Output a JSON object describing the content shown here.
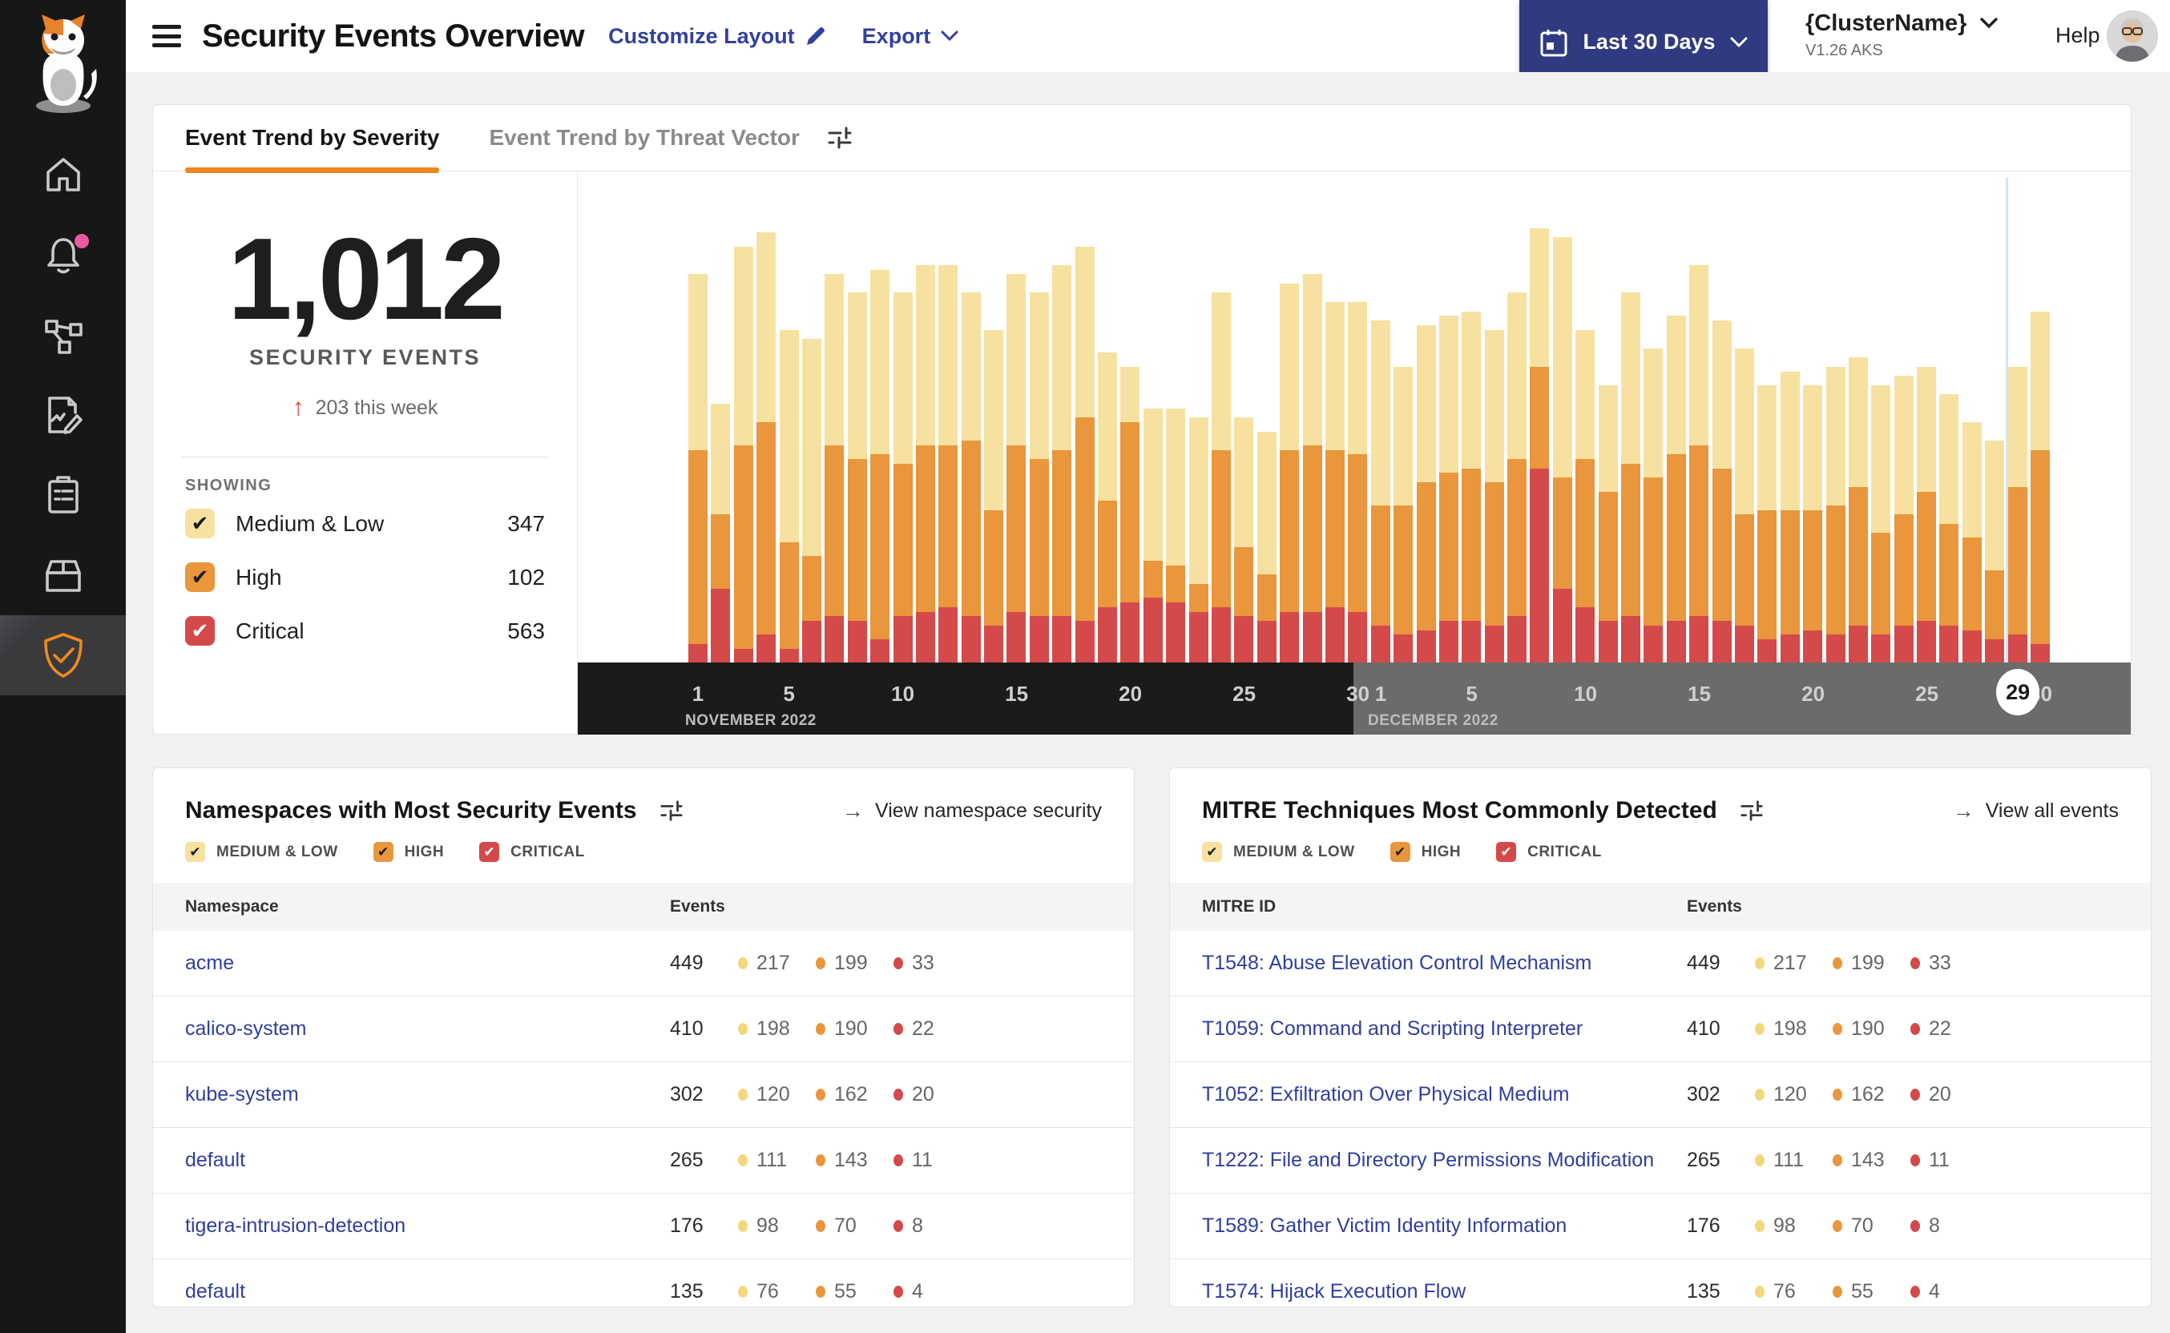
{
  "header": {
    "title": "Security Events Overview",
    "customize_layout": "Customize Layout",
    "export": "Export",
    "date_range": "Last 30 Days",
    "cluster_name": "{ClusterName}",
    "cluster_version": "V1.26 AKS",
    "help": "Help"
  },
  "tabs": {
    "severity": "Event Trend by Severity",
    "threat_vector": "Event Trend by Threat Vector"
  },
  "summary": {
    "total": "1,012",
    "label": "SECURITY EVENTS",
    "delta": "203 this week",
    "showing_label": "SHOWING",
    "filters": [
      {
        "label": "Medium & Low",
        "count": "347",
        "box": "#F6E1A0",
        "check": "#1C1C1C"
      },
      {
        "label": "High",
        "count": "102",
        "box": "#E9963C",
        "check": "#1C1C1C"
      },
      {
        "label": "Critical",
        "count": "563",
        "box": "#D4494A",
        "check": "#FFFFFF"
      }
    ]
  },
  "colors": {
    "medium_low": "#F6E1A0",
    "high": "#E9963C",
    "critical": "#D4494A",
    "accent_orange": "#F0861F",
    "navy": "#2F3A80",
    "link_navy": "#32409F",
    "axis_nov_bg": "#1B1B1B",
    "axis_dec_bg": "#6B6B6B",
    "now_line": "#CFE6F5"
  },
  "chart_data": {
    "type": "bar",
    "stacked": true,
    "title": "Event Trend by Severity (security events per day)",
    "x_axis": {
      "months": [
        {
          "label": "NOVEMBER 2022",
          "ticks": [
            1,
            5,
            10,
            15,
            20,
            25,
            30
          ],
          "days": 30
        },
        {
          "label": "DECEMBER 2022",
          "ticks": [
            1,
            5,
            10,
            15,
            20,
            25,
            30
          ],
          "days": 30,
          "selected_day": 29
        }
      ]
    },
    "y_axis": {
      "visible": false,
      "values_unit": "percent_of_plot_height"
    },
    "legend_position": "left-panel-checkboxes",
    "series": [
      {
        "name": "Medium & Low",
        "color": "#F6E1A0",
        "values": [
          38,
          24,
          43,
          41,
          46,
          47,
          37,
          36,
          40,
          37,
          39,
          39,
          32,
          39,
          37,
          36,
          40,
          37,
          32,
          12,
          33,
          34,
          36,
          34,
          28,
          31,
          36,
          37,
          32,
          33,
          40,
          30,
          34,
          34,
          34,
          33,
          36,
          30,
          52,
          28,
          23,
          37,
          28,
          30,
          39,
          32,
          36,
          27,
          30,
          27,
          30,
          28,
          32,
          30,
          27,
          28,
          25,
          28,
          26,
          30
        ]
      },
      {
        "name": "High",
        "color": "#E9963C",
        "values": [
          42,
          16,
          44,
          46,
          23,
          14,
          37,
          35,
          40,
          33,
          36,
          35,
          38,
          25,
          36,
          34,
          36,
          44,
          23,
          39,
          8,
          8,
          6,
          34,
          15,
          10,
          35,
          36,
          34,
          34,
          26,
          28,
          32,
          32,
          33,
          31,
          34,
          22,
          24,
          32,
          28,
          33,
          32,
          36,
          37,
          33,
          24,
          28,
          27,
          26,
          28,
          30,
          22,
          24,
          28,
          22,
          20,
          15,
          32,
          42
        ]
      },
      {
        "name": "Critical",
        "color": "#D4494A",
        "values": [
          4,
          16,
          3,
          6,
          3,
          9,
          10,
          9,
          5,
          10,
          11,
          12,
          10,
          8,
          11,
          10,
          10,
          9,
          12,
          13,
          14,
          13,
          11,
          12,
          10,
          9,
          11,
          11,
          12,
          11,
          8,
          6,
          7,
          9,
          9,
          8,
          10,
          42,
          16,
          12,
          9,
          10,
          8,
          9,
          10,
          9,
          8,
          5,
          6,
          7,
          6,
          8,
          6,
          8,
          9,
          8,
          7,
          5,
          6,
          4
        ]
      }
    ],
    "highlight": {
      "month": "DECEMBER 2022",
      "day": 29
    }
  },
  "cards": {
    "namespaces": {
      "title": "Namespaces with Most Security Events",
      "link": "View namespace security",
      "filters": [
        "MEDIUM & LOW",
        "HIGH",
        "CRITICAL"
      ],
      "columns": [
        "Namespace",
        "Events"
      ],
      "rows": [
        {
          "name": "acme",
          "total": "449",
          "low": "217",
          "high": "199",
          "critical": "33"
        },
        {
          "name": "calico-system",
          "total": "410",
          "low": "198",
          "high": "190",
          "critical": "22"
        },
        {
          "name": "kube-system",
          "total": "302",
          "low": "120",
          "high": "162",
          "critical": "20"
        },
        {
          "name": "default",
          "total": "265",
          "low": "111",
          "high": "143",
          "critical": "11"
        },
        {
          "name": "tigera-intrusion-detection",
          "total": "176",
          "low": "98",
          "high": "70",
          "critical": "8"
        },
        {
          "name": "default",
          "total": "135",
          "low": "76",
          "high": "55",
          "critical": "4"
        }
      ]
    },
    "mitre": {
      "title": "MITRE Techniques Most Commonly Detected",
      "link": "View all events",
      "filters": [
        "MEDIUM & LOW",
        "HIGH",
        "CRITICAL"
      ],
      "columns": [
        "MITRE ID",
        "Events"
      ],
      "rows": [
        {
          "name": "T1548: Abuse Elevation Control Mechanism",
          "total": "449",
          "low": "217",
          "high": "199",
          "critical": "33"
        },
        {
          "name": "T1059: Command and Scripting Interpreter",
          "total": "410",
          "low": "198",
          "high": "190",
          "critical": "22"
        },
        {
          "name": "T1052: Exfiltration Over Physical Medium",
          "total": "302",
          "low": "120",
          "high": "162",
          "critical": "20"
        },
        {
          "name": "T1222: File and Directory Permissions Modification",
          "total": "265",
          "low": "111",
          "high": "143",
          "critical": "11"
        },
        {
          "name": "T1589: Gather Victim Identity Information",
          "total": "176",
          "low": "98",
          "high": "70",
          "critical": "8"
        },
        {
          "name": "T1574: Hijack Execution Flow",
          "total": "135",
          "low": "76",
          "high": "55",
          "critical": "4"
        }
      ]
    }
  }
}
